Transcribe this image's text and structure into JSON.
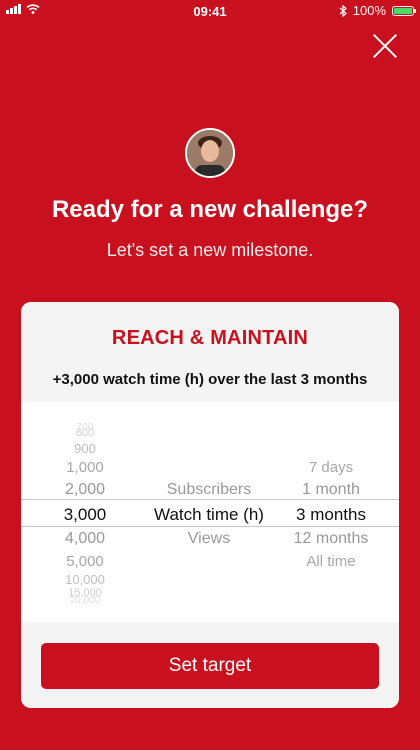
{
  "status_bar": {
    "time": "09:41",
    "battery": "100%"
  },
  "hero": {
    "title": "Ready for a new challenge?",
    "subtitle": "Let's set a new milestone."
  },
  "card": {
    "title": "REACH & MAINTAIN",
    "description": "+3,000 watch time (h) over the last 3 months",
    "picker": {
      "amounts": [
        "700",
        "800",
        "900",
        "1,000",
        "2,000",
        "3,000",
        "4,000",
        "5,000",
        "10,000",
        "15,000",
        "20,000"
      ],
      "selected_amount": "3,000",
      "metrics": [
        "Subscribers",
        "Watch time (h)",
        "Views"
      ],
      "selected_metric": "Watch time (h)",
      "periods": [
        "7 days",
        "1 month",
        "3 months",
        "12 months",
        "All time"
      ],
      "selected_period": "3 months"
    },
    "button_label": "Set target"
  }
}
